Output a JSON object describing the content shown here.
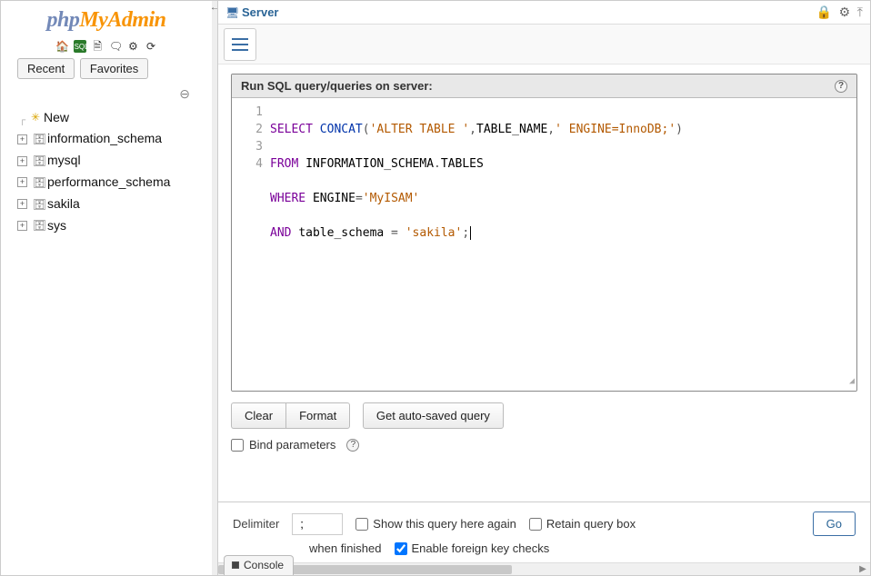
{
  "logo": {
    "part1": "php",
    "part2": "MyAdmin"
  },
  "toolbar_icons": [
    "home-icon",
    "sql-icon",
    "doc-icon",
    "chat-icon",
    "gear-icon",
    "reload-icon"
  ],
  "sidebar_tabs": {
    "recent": "Recent",
    "favorites": "Favorites"
  },
  "tree": {
    "new_label": "New",
    "databases": [
      "information_schema",
      "mysql",
      "performance_schema",
      "sakila",
      "sys"
    ]
  },
  "server": {
    "label": "Server"
  },
  "status_icons": {
    "cog": "⚙",
    "warn": "❉",
    "collapse": "⤒",
    "lock": "🔒"
  },
  "query_box_title": "Run SQL query/queries on server:",
  "editor": {
    "line_numbers": [
      "1",
      "2",
      "3",
      "4"
    ],
    "lines": {
      "l1": {
        "kw1": "SELECT",
        "fn": "CONCAT",
        "lp": "(",
        "s1": "'ALTER TABLE '",
        "c1": ",",
        "id": "TABLE_NAME",
        "c2": ",",
        "s2": "' ENGINE=InnoDB;'",
        "rp": ")"
      },
      "l2": {
        "kw1": "FROM",
        "id1": "INFORMATION_SCHEMA",
        "dot": ".",
        "id2": "TABLES"
      },
      "l3": {
        "kw1": "WHERE",
        "id": "ENGINE",
        "eq": "=",
        "s": "'MyISAM'"
      },
      "l4": {
        "kw1": "AND",
        "id": "table_schema",
        "eq": " = ",
        "s": "'sakila'",
        "end": ";"
      }
    }
  },
  "buttons": {
    "clear": "Clear",
    "format": "Format",
    "autosaved": "Get auto-saved query"
  },
  "bind_params_label": "Bind parameters",
  "footer": {
    "delimiter_label": "Delimiter",
    "delimiter_value": ";",
    "show_again": "Show this query here again",
    "retain": "Retain query box",
    "rollback": "when finished",
    "enable_fk": "Enable foreign key checks",
    "go": "Go",
    "console": "Console"
  }
}
